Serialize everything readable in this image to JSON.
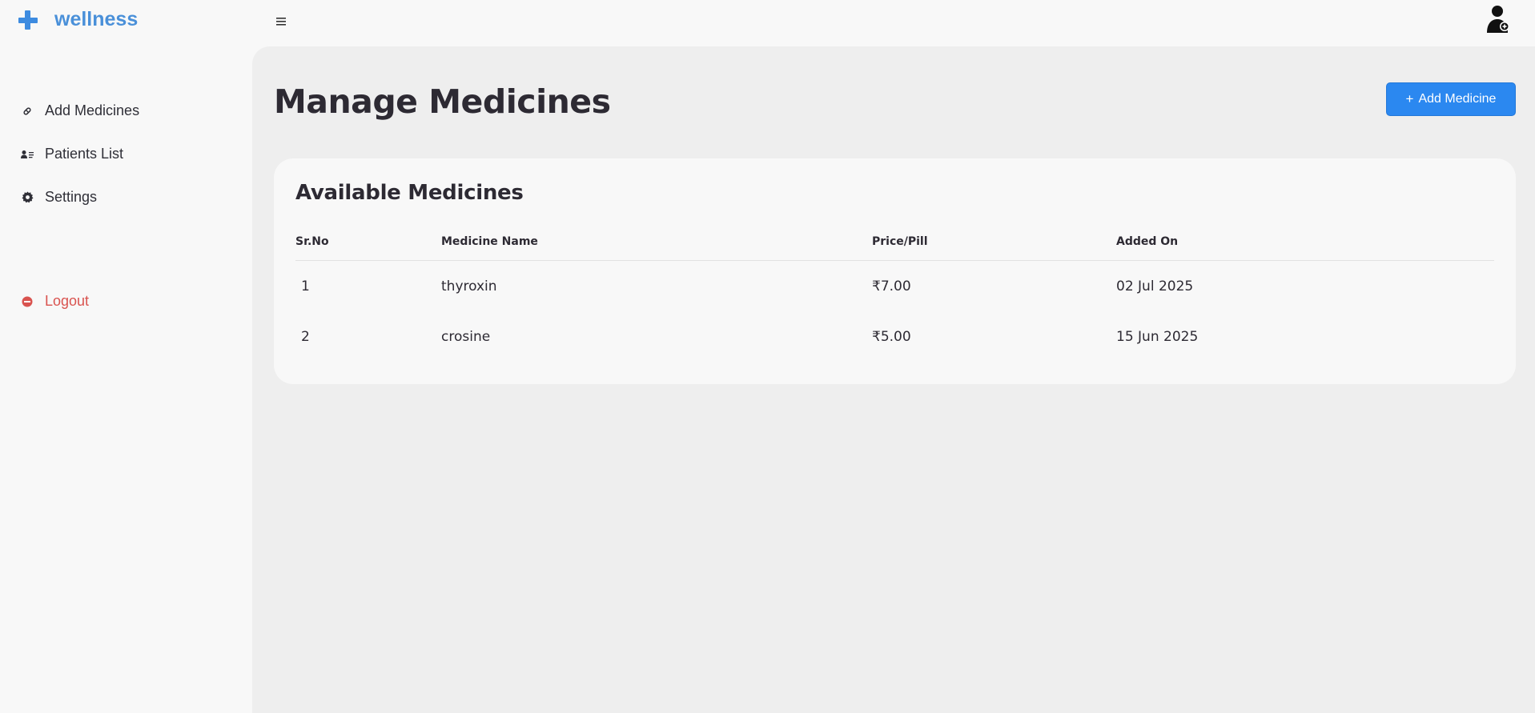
{
  "brand": {
    "name": "wellness",
    "accent": "#3d8be0"
  },
  "header": {
    "menu_icon": "hamburger-icon",
    "avatar_icon": "doctor-avatar-icon"
  },
  "sidebar": {
    "items": [
      {
        "label": "Add Medicines",
        "icon": "pill-icon"
      },
      {
        "label": "Patients List",
        "icon": "patients-list-icon"
      },
      {
        "label": "Settings",
        "icon": "gear-icon"
      }
    ],
    "logout": {
      "label": "Logout",
      "icon": "logout-icon",
      "color": "#d9534f"
    }
  },
  "main": {
    "title": "Manage Medicines",
    "add_button": {
      "label": "Add Medicine",
      "icon": "+",
      "color": "#2b88f0"
    },
    "card": {
      "title": "Available Medicines",
      "columns": [
        "Sr.No",
        "Medicine Name",
        "Price/Pill",
        "Added On"
      ],
      "rows": [
        {
          "sr": "1",
          "name": "thyroxin",
          "price": "₹7.00",
          "added": "02 Jul 2025"
        },
        {
          "sr": "2",
          "name": "crosine",
          "price": "₹5.00",
          "added": "15 Jun 2025"
        }
      ]
    }
  }
}
